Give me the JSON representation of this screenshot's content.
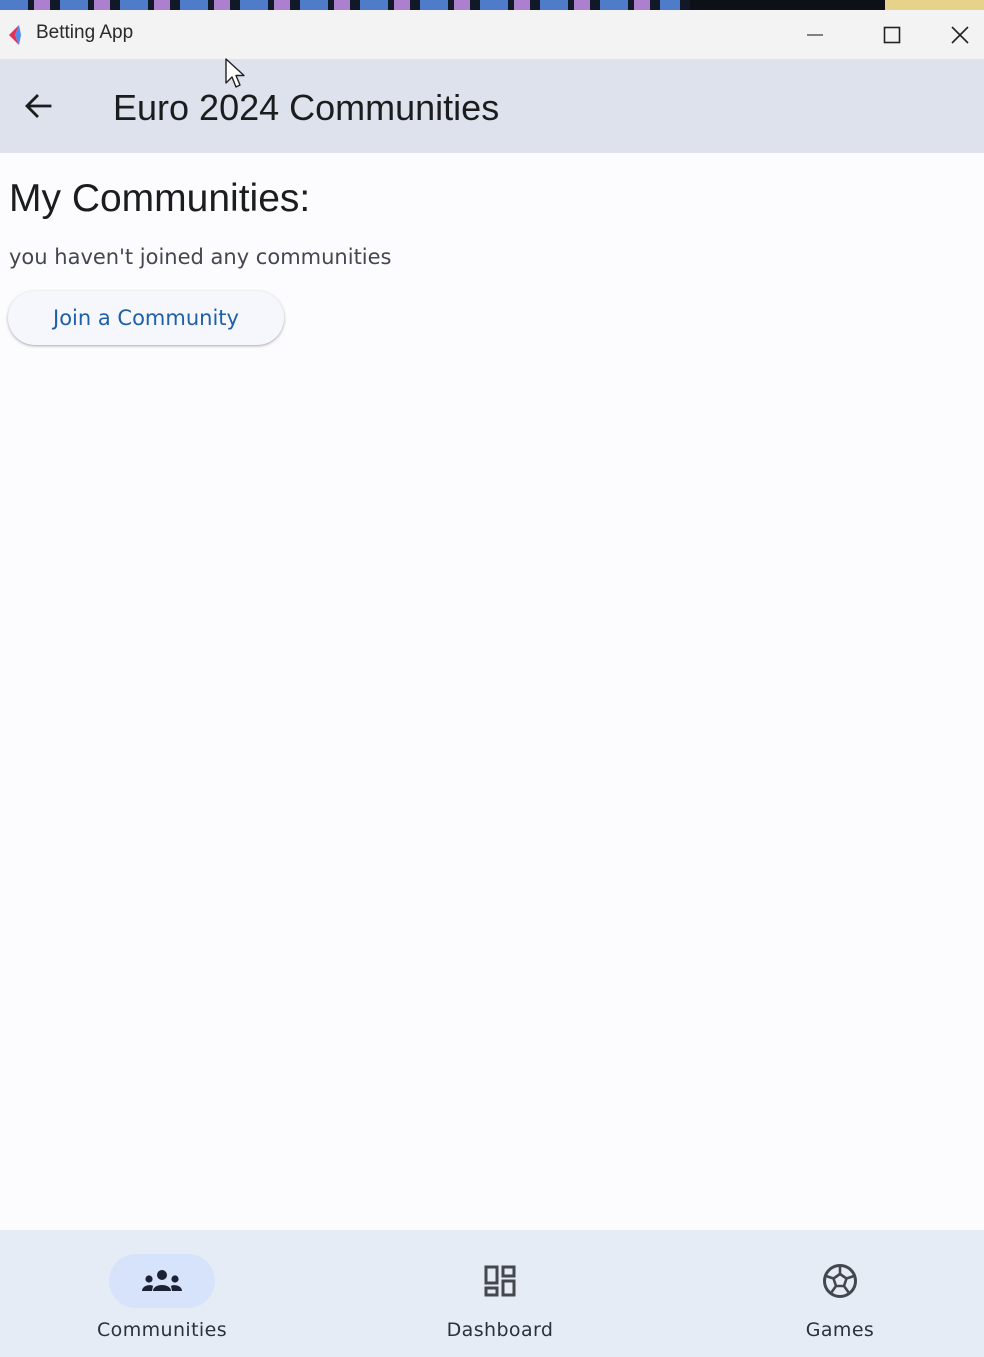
{
  "window": {
    "title": "Betting App",
    "controls": [
      "minimize-icon",
      "maximize-icon",
      "close-icon"
    ]
  },
  "appbar": {
    "back_icon": "arrow-back-icon",
    "title": "Euro 2024 Communities"
  },
  "main": {
    "heading": "My Communities:",
    "empty_message": "you haven't joined any communities",
    "join_button_label": "Join a Community"
  },
  "bottom_nav": {
    "items": [
      {
        "label": "Communities",
        "icon": "groups-icon",
        "active": true
      },
      {
        "label": "Dashboard",
        "icon": "dashboard-icon",
        "active": false
      },
      {
        "label": "Games",
        "icon": "soccer-ball-icon",
        "active": false
      }
    ]
  },
  "colors": {
    "appbar_bg": "#dde2ec",
    "nav_bg": "#e6ecf6",
    "active_pill": "#d6e3fb",
    "button_text": "#1e5fa8"
  }
}
